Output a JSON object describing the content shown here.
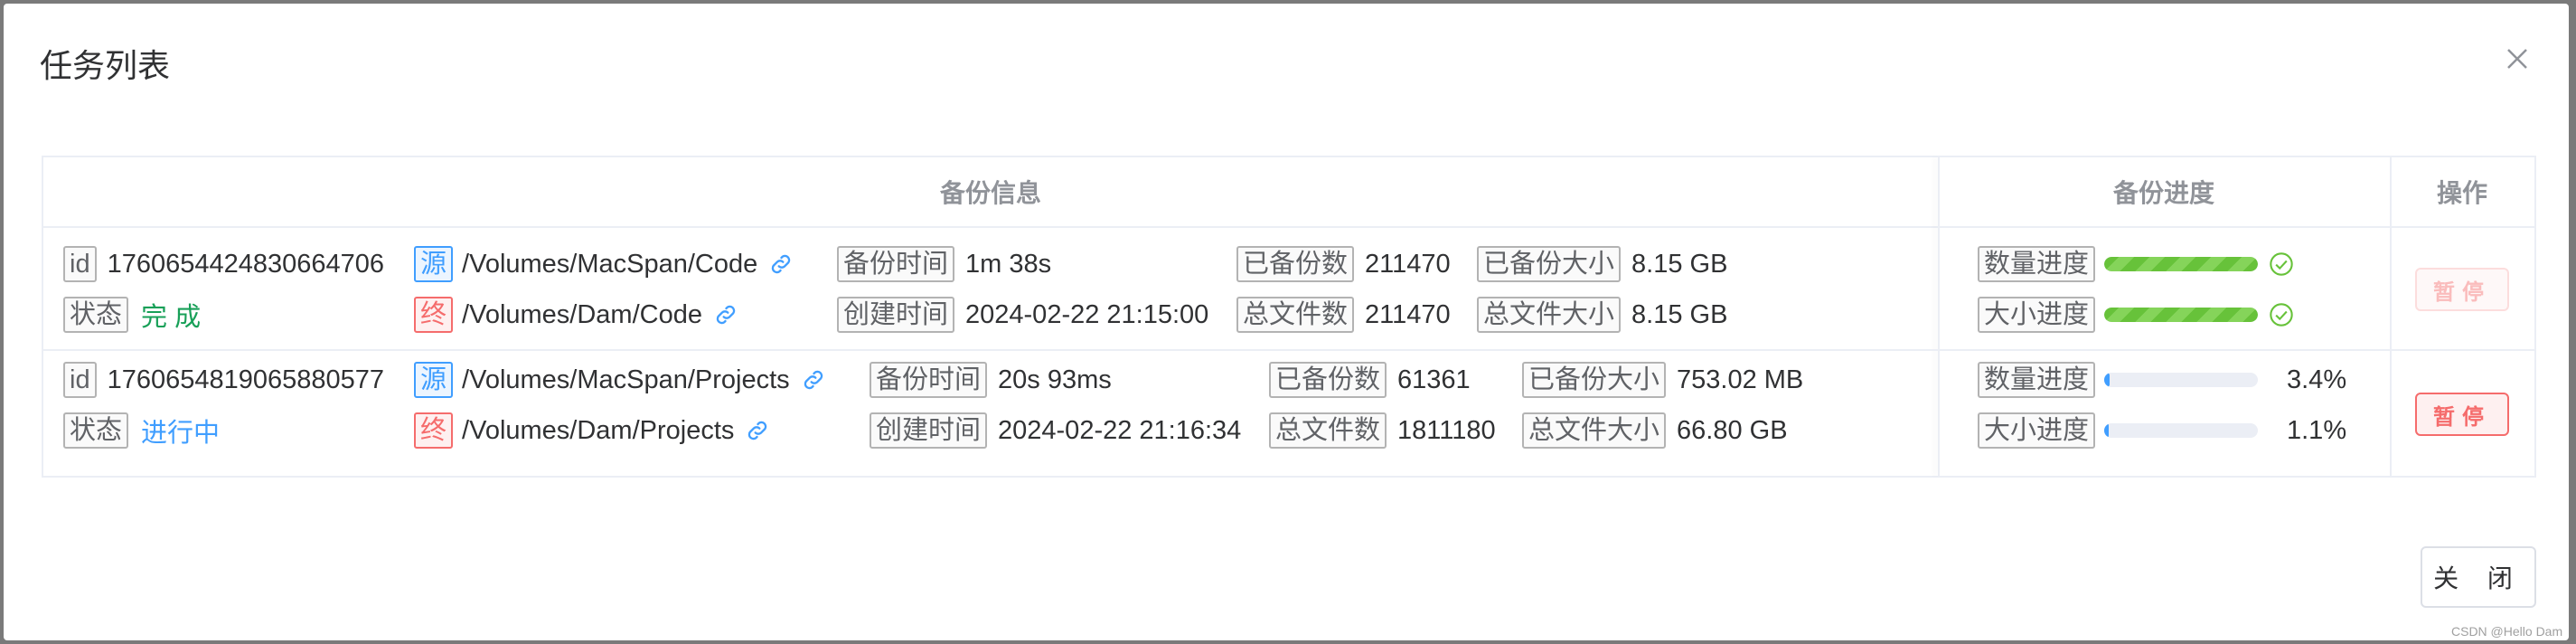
{
  "dialog": {
    "title": "任务列表",
    "close_button": "关 闭",
    "watermark": "CSDN @Hello Dam"
  },
  "table": {
    "headers": {
      "info": "备份信息",
      "progress": "备份进度",
      "action": "操作"
    },
    "labels": {
      "id": "id",
      "status": "状态",
      "source": "源",
      "dest": "终",
      "backup_time": "备份时间",
      "create_time": "创建时间",
      "backed_count": "已备份数",
      "total_count": "总文件数",
      "backed_size": "已备份大小",
      "total_size": "总文件大小",
      "count_progress": "数量进度",
      "size_progress": "大小进度"
    },
    "rows": [
      {
        "id": "1760654424830664706",
        "status": "完 成",
        "source": "/Volumes/MacSpan/Code",
        "dest": "/Volumes/Dam/Code",
        "backup_time": "1m 38s",
        "create_time": "2024-02-22 21:15:00",
        "backed_count": "211470",
        "total_count": "211470",
        "backed_size": "8.15 GB",
        "total_size": "8.15 GB",
        "count_progress": 1.0,
        "size_progress": 1.0,
        "count_pct": "",
        "size_pct": "",
        "action": "暂停"
      },
      {
        "id": "1760654819065880577",
        "status": "进行中",
        "source": "/Volumes/MacSpan/Projects",
        "dest": "/Volumes/Dam/Projects",
        "backup_time": "20s 93ms",
        "create_time": "2024-02-22 21:16:34",
        "backed_count": "61361",
        "total_count": "1811180",
        "backed_size": "753.02 MB",
        "total_size": "66.80 GB",
        "count_progress": 0.034,
        "size_progress": 0.011,
        "count_pct": "3.4%",
        "size_pct": "1.1%",
        "action": "暂停"
      }
    ]
  }
}
